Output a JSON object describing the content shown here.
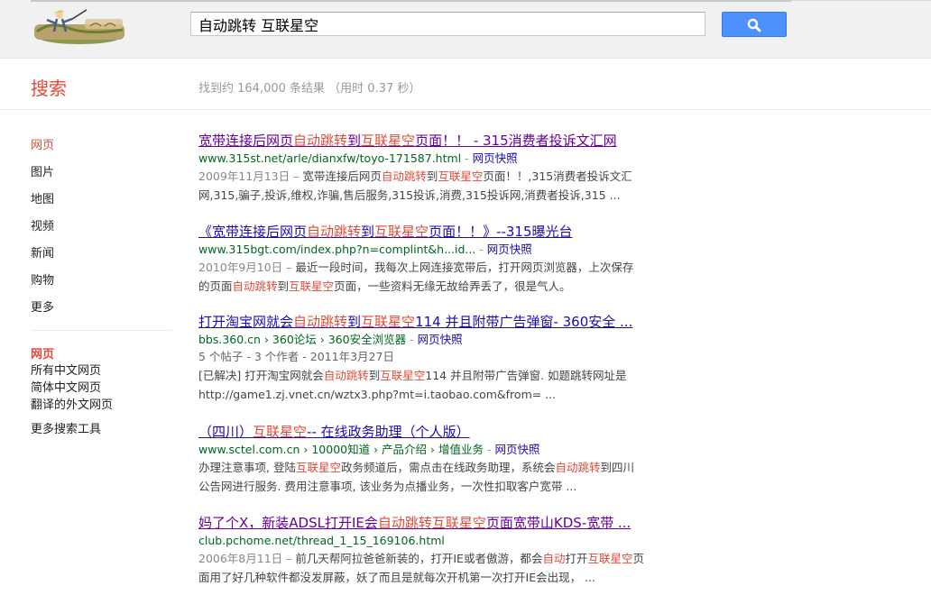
{
  "search": {
    "query": "自动跳转 互联星空"
  },
  "header": {
    "title": "搜索",
    "stats": "找到约 164,000 条结果 （用时 0.37 秒）"
  },
  "leftnav": {
    "items": [
      "网页",
      "图片",
      "地图",
      "视频",
      "新闻",
      "购物",
      "更多"
    ],
    "tools": [
      "网页",
      "所有中文网页",
      "简体中文网页",
      "翻译的外文网页",
      "更多搜索工具"
    ]
  },
  "results": [
    {
      "title_parts": [
        "宽带连接后网页",
        "自动跳转",
        "到",
        "互联星空",
        "页面！！ - 315消费者投诉文汇网"
      ],
      "url": "www.315st.net/arle/dianxfw/toyo-171587.html",
      "sep": " - ",
      "cache": "网页快照",
      "meta": "",
      "snippet_lines": [
        [
          "2009年11月13日 – ",
          "宽带连接后网页",
          "自动跳转",
          "到",
          "互联星空",
          "页面！！,315消费者投诉文汇"
        ],
        [
          "网,315,骗子,投诉,维权,诈骗,售后服务,315投诉,消费,315投诉网,消费者投诉,315 ..."
        ]
      ]
    },
    {
      "title_parts": [
        "《宽带连接后网页",
        "自动跳转",
        "到",
        "互联星空",
        "页面！！》--315曝光台"
      ],
      "url": "www.315bgt.com/index.php?n=complint&h...id...",
      "sep": " - ",
      "cache": "网页快照",
      "meta": "",
      "snippet_lines": [
        [
          "2010年9月10日 – ",
          "最近一段时间，我每次上网连接宽带后，打开网页浏览器，上次保存"
        ],
        [
          "的页面",
          "自动跳转",
          "到",
          "互联星空",
          "页面，一些资料无缘无故给弄丢了，很是气人。"
        ]
      ]
    },
    {
      "title_parts": [
        "打开淘宝网就会",
        "自动跳转",
        "到",
        "互联星空",
        "114 并且附带广告弹窗- 360安全 ..."
      ],
      "url": "bbs.360.cn › 360论坛 › 360安全浏览器",
      "sep": " - ",
      "cache": "网页快照",
      "meta": "5 个帖子 - 3 个作者 - 2011年3月27日",
      "snippet_lines": [
        [
          "[已解决] 打开淘宝网就会",
          "自动跳转",
          "到",
          "互联星空",
          "114 并且附带广告弹窗. 如题跳转网址是"
        ],
        [
          "http://game1.zj.vnet.cn/wztx3.php?mt=i.taobao.com&from= ..."
        ]
      ]
    },
    {
      "title_parts": [
        "（四川）",
        "互联星空",
        "-- 在线政务助理（个人版）"
      ],
      "url": "www.sctel.com.cn › 10000知道 › 产品介绍 › 增值业务",
      "sep": " - ",
      "cache": "网页快照",
      "meta": "",
      "snippet_lines": [
        [
          "办理注意事项, 登陆",
          "互联星空",
          "政务频道后，需点击在线政务助理，系统会",
          "自动跳转",
          "到四川"
        ],
        [
          "公告网进行服务. 费用注意事项, 该业务为点播业务，一次性扣取客户宽带 ..."
        ]
      ]
    },
    {
      "title_parts": [
        "妈了个X，新装ADSL打开IE会",
        "自动跳转",
        "互联星空",
        "页面宽带山KDS-宽带 ..."
      ],
      "url": "club.pchome.net/thread_1_15_169106.html",
      "sep": "",
      "cache": "",
      "meta": "",
      "snippet_lines": [
        [
          "2006年8月11日 – ",
          "前几天帮阿拉爸爸新装的，打开IE或者傲游，都会",
          "自动",
          "打开",
          "互联星空",
          "页"
        ],
        [
          "面用了好几种软件都没发屏蔽，妖了而且是就每次开机第一次打开IE会出现， ..."
        ]
      ]
    }
  ],
  "colors": {
    "accent": "#dd4b39",
    "link": "#1a0dab",
    "visited": "#660099",
    "url": "#006621",
    "button": "#4d90fe"
  }
}
